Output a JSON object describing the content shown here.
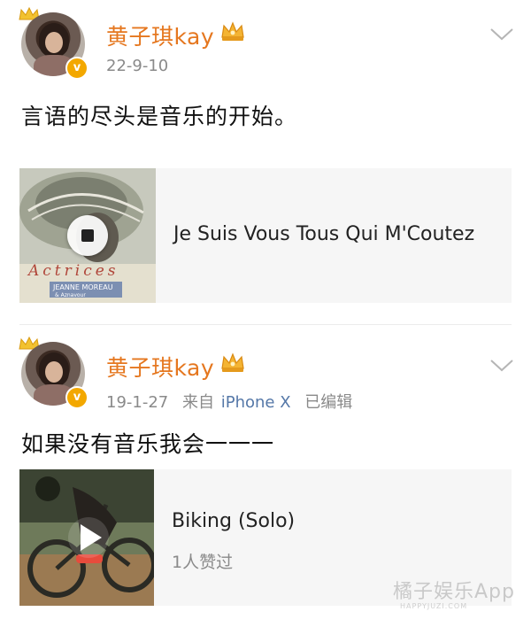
{
  "posts": [
    {
      "username": "黄子琪kay",
      "date": "22-9-10",
      "source": "",
      "edited": "",
      "text": "言语的尽头是音乐的开始。",
      "card": {
        "title": "Je Suis Vous Tous Qui M'Coutez",
        "subtitle": "",
        "cover_text": "JEANNE MOREAU",
        "cover_script": "Actrices",
        "cover_small": "& Aznavour"
      },
      "playing_state": "stop-icon"
    },
    {
      "username": "黄子琪kay",
      "date": "19-1-27",
      "source_prefix": "来自",
      "source": "iPhone X",
      "edited": "已编辑",
      "text": "如果没有音乐我会一一一",
      "card": {
        "title": "Biking (Solo)",
        "subtitle": "1人赞过"
      },
      "playing_state": "play-icon"
    }
  ],
  "watermark": {
    "main": "橘子娱乐App",
    "sub": "HAPPYJUZI.COM"
  },
  "colors": {
    "username": "#e5771f",
    "verified": "#f3a800",
    "link": "#5578a8",
    "meta": "#8a8a8a",
    "card_bg": "#f6f6f6"
  }
}
